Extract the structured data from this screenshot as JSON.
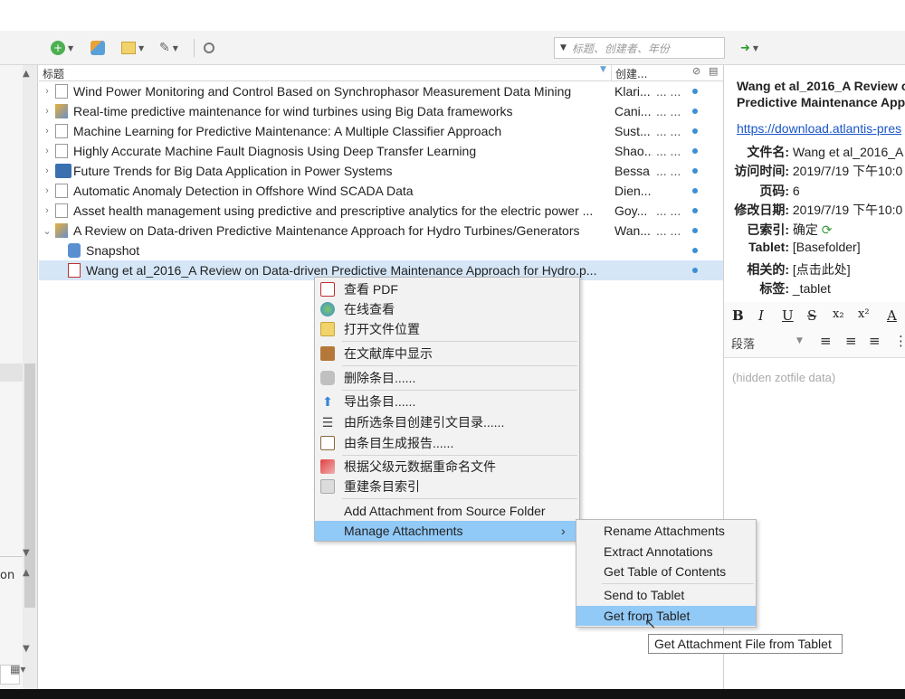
{
  "search": {
    "placeholder": "标题、创建者、年份"
  },
  "left": {
    "partial_text": "on"
  },
  "columns": {
    "title": "标题",
    "creator": "创建..."
  },
  "rows": [
    {
      "title": "Wind Power Monitoring and Control Based on Synchrophasor Measurement Data Mining",
      "creator": "Klari...",
      "date": "...   ..."
    },
    {
      "title": "Real-time predictive maintenance for wind turbines using Big Data frameworks",
      "creator": "Cani...",
      "date": "...   ..."
    },
    {
      "title": "Machine Learning for Predictive Maintenance: A Multiple Classifier Approach",
      "creator": "Sust...",
      "date": "...   ..."
    },
    {
      "title": "Highly Accurate Machine Fault Diagnosis Using Deep Transfer Learning",
      "creator": "Shao...",
      "date": "...   ..."
    },
    {
      "title": "Future Trends for Big Data Application in Power Systems",
      "creator": "Bessa",
      "date": "...   ..."
    },
    {
      "title": "Automatic Anomaly Detection in Offshore Wind SCADA Data",
      "creator": "Dien...",
      "date": ""
    },
    {
      "title": "Asset health management using predictive and prescriptive analytics for the electric power ...",
      "creator": "Goy...",
      "date": "...   ..."
    },
    {
      "title": "A Review on Data-driven Predictive Maintenance Approach for Hydro Turbines/Generators",
      "creator": "Wan...",
      "date": "...   ..."
    },
    {
      "title": "Snapshot",
      "creator": "",
      "date": ""
    },
    {
      "title": "Wang et al_2016_A Review on Data-driven Predictive Maintenance Approach for Hydro.p...",
      "creator": "",
      "date": ""
    }
  ],
  "context_menu": [
    "查看 PDF",
    "在线查看",
    "打开文件位置",
    "在文献库中显示",
    "删除条目......",
    "导出条目......",
    "由所选条目创建引文目录......",
    "由条目生成报告......",
    "根据父级元数据重命名文件",
    "重建条目索引",
    "Add Attachment from Source Folder",
    "Manage Attachments"
  ],
  "submenu": [
    "Rename Attachments",
    "Extract Annotations",
    "Get Table of Contents",
    "Send to Tablet",
    "Get from Tablet"
  ],
  "tooltip": "Get Attachment File from Tablet",
  "right": {
    "title_line1": "Wang et al_2016_A Review o",
    "title_line2": "Predictive Maintenance App",
    "link": "https://download.atlantis-pres",
    "fields": [
      {
        "k": "文件名:",
        "v": "Wang et al_2016_A"
      },
      {
        "k": "访问时间:",
        "v": "2019/7/19 下午10:0"
      },
      {
        "k": "页码:",
        "v": "6"
      },
      {
        "k": "修改日期:",
        "v": "2019/7/19 下午10:0"
      },
      {
        "k": "已索引:",
        "v": "确定"
      },
      {
        "k": "Tablet:",
        "v": "[Basefolder]"
      },
      {
        "k": "相关的:",
        "v": "[点击此处]"
      },
      {
        "k": "标签:",
        "v": "_tablet"
      }
    ],
    "paragraph": "段落",
    "hidden_note": "(hidden zotfile data)"
  }
}
